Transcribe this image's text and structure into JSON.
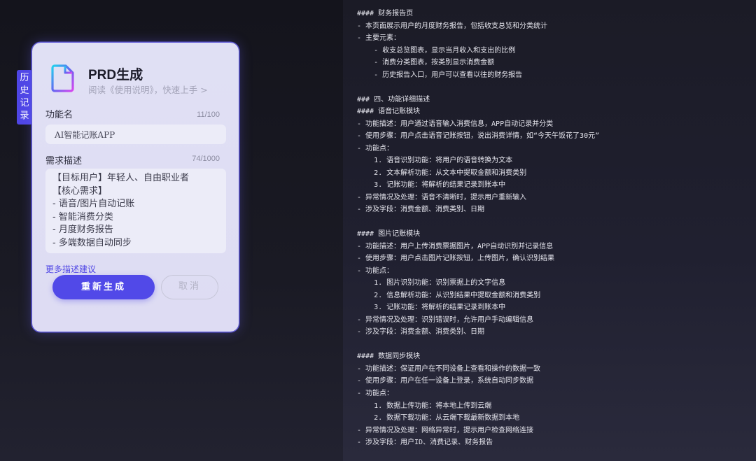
{
  "history_tab": {
    "chars": [
      "历",
      "史",
      "记",
      "录"
    ]
  },
  "card": {
    "title": "PRD生成",
    "subtitle": "阅读《使用说明》，快速上手 >",
    "feature_name": {
      "label": "功能名",
      "counter": "11/100",
      "value": "AI智能记账APP"
    },
    "description": {
      "label": "需求描述",
      "counter": "74/1000",
      "lines": [
        "【目标用户】年轻人、自由职业者",
        "【核心需求】",
        "- 语音/图片自动记账",
        "- 智能消费分类",
        "- 月度财务报告",
        "- 多端数据自动同步"
      ]
    },
    "more_link": "更多描述建议",
    "regenerate_label": "重新生成",
    "cancel_label": "取消"
  },
  "document": {
    "lines": [
      "#### 财务报告页",
      "- 本页面展示用户的月度财务报告，包括收支总览和分类统计",
      "- 主要元素：",
      "    - 收支总览图表，显示当月收入和支出的比例",
      "    - 消费分类图表，按类别显示消费金额",
      "    - 历史报告入口，用户可以查看以往的财务报告",
      "",
      "### 四、功能详细描述",
      "#### 语音记账模块",
      "- 功能描述：用户通过语音输入消费信息，APP自动记录并分类",
      "- 使用步骤：用户点击语音记账按钮，说出消费详情，如“今天午饭花了30元”",
      "- 功能点：",
      "    1. 语音识别功能：将用户的语音转换为文本",
      "    2. 文本解析功能：从文本中提取金额和消费类别",
      "    3. 记账功能：将解析的结果记录到账本中",
      "- 异常情况及处理：语音不清晰时，提示用户重新输入",
      "- 涉及字段：消费金额、消费类别、日期",
      "",
      "#### 图片记账模块",
      "- 功能描述：用户上传消费票据图片，APP自动识别并记录信息",
      "- 使用步骤：用户点击图片记账按钮，上传图片，确认识别结果",
      "- 功能点：",
      "    1. 图片识别功能：识别票据上的文字信息",
      "    2. 信息解析功能：从识别结果中提取金额和消费类别",
      "    3. 记账功能：将解析的结果记录到账本中",
      "- 异常情况及处理：识别错误时，允许用户手动编辑信息",
      "- 涉及字段：消费金额、消费类别、日期",
      "",
      "#### 数据同步模块",
      "- 功能描述：保证用户在不同设备上查看和操作的数据一致",
      "- 使用步骤：用户在任一设备上登录，系统自动同步数据",
      "- 功能点：",
      "    1. 数据上传功能：将本地上传到云端",
      "    2. 数据下载功能：从云端下载最新数据到本地",
      "- 异常情况及处理：网络异常时，提示用户检查网络连接",
      "- 涉及字段：用户ID、消费记录、财务报告"
    ]
  },
  "colors": {
    "accent": "#5149e8",
    "panel_bg": "#dedcf3",
    "document_bg": "#1b1b26"
  },
  "icons": [
    "document-icon"
  ]
}
